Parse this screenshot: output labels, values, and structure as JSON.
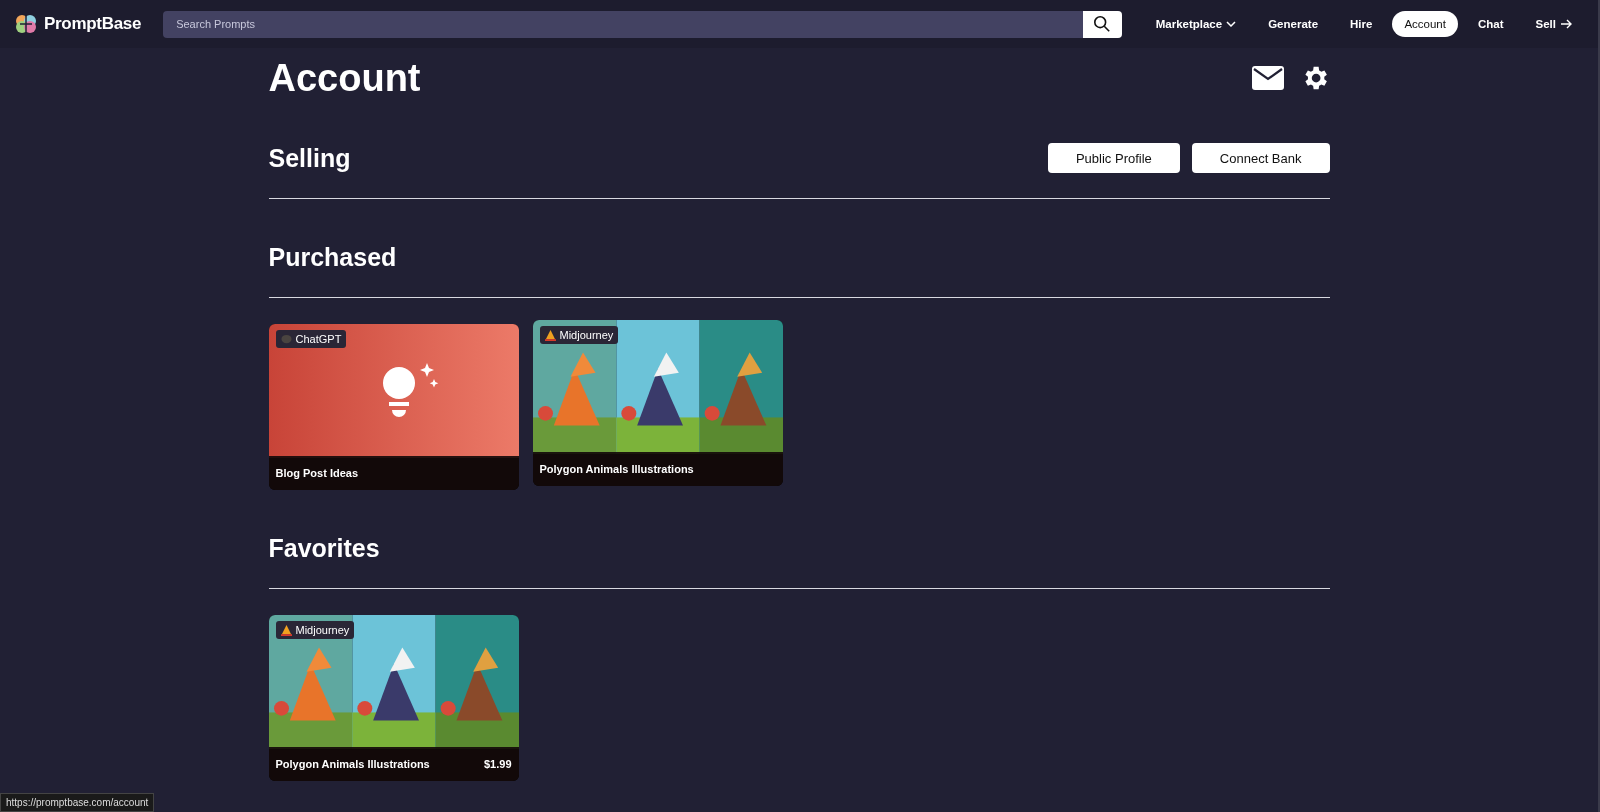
{
  "nav": {
    "brand": "PromptBase",
    "search": {
      "placeholder": "Search Prompts"
    },
    "items": [
      {
        "label": "Marketplace",
        "kind": "dropdown",
        "selected": false
      },
      {
        "label": "Generate",
        "kind": "link",
        "selected": false
      },
      {
        "label": "Hire",
        "kind": "link",
        "selected": false
      },
      {
        "label": "Account",
        "kind": "link",
        "selected": true
      },
      {
        "label": "Chat",
        "kind": "link",
        "selected": false
      },
      {
        "label": "Sell",
        "kind": "arrow",
        "selected": false
      }
    ]
  },
  "page": {
    "title": "Account"
  },
  "sections": [
    {
      "heading": "Selling",
      "buttons": [
        "Public Profile",
        "Connect Bank"
      ]
    },
    {
      "heading": "Purchased",
      "cards": [
        {
          "title": "Blog Post Ideas",
          "badge": {
            "label": "ChatGPT",
            "kind": "bubble"
          },
          "kind": "illustration"
        },
        {
          "title": "Polygon Animals Illustrations",
          "badge": {
            "label": "Midjourney",
            "kind": "sailboat"
          },
          "kind": "picture"
        }
      ]
    },
    {
      "heading": "Favorites",
      "cards": [
        {
          "title": "Polygon Animals Illustrations",
          "badge": {
            "label": "Midjourney",
            "kind": "sailboat"
          },
          "kind": "picture",
          "price": "$1.99"
        }
      ]
    }
  ],
  "status_bar": {
    "url": "https://promptbase.com/account"
  }
}
